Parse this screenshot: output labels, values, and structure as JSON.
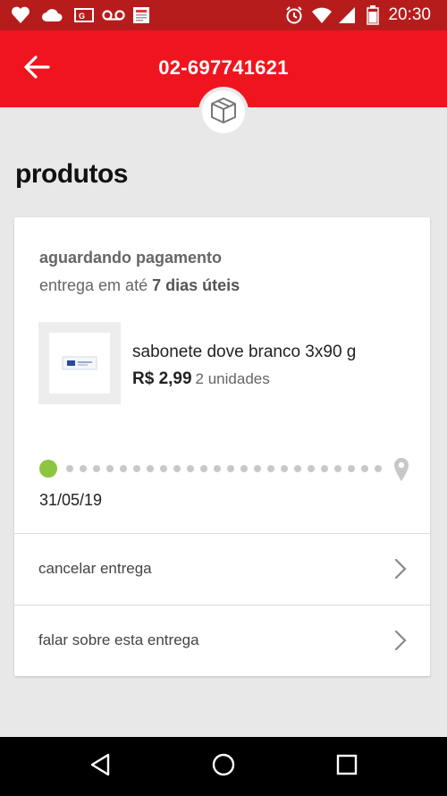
{
  "status_bar": {
    "time": "20:30",
    "icons": [
      "heart-icon",
      "cloud-icon",
      "card-icon",
      "voicemail-icon",
      "news-icon",
      "alarm-icon",
      "wifi-icon",
      "signal-icon",
      "battery-icon"
    ]
  },
  "app_bar": {
    "title": "02-697741621",
    "back_icon": "arrow-left-icon",
    "badge_icon": "box-icon"
  },
  "section": {
    "title": "produtos"
  },
  "card": {
    "status": "aguardando pagamento",
    "delivery_prefix": "entrega em até",
    "delivery_days": "7 dias úteis",
    "product": {
      "name": "sabonete dove branco 3x90 g",
      "price": "R$ 2,99",
      "units": "2 unidades"
    },
    "tracker": {
      "date": "31/05/19",
      "progress_colors": {
        "done": "#8cc63f",
        "pending": "#c8c8c8"
      }
    },
    "actions": [
      {
        "label": "cancelar entrega"
      },
      {
        "label": "falar sobre esta entrega"
      }
    ]
  },
  "colors": {
    "brand_red": "#f0141e",
    "status_bar": "#b71c1c",
    "background": "#e8e8e8"
  },
  "nav": {
    "icons": [
      "back-triangle-icon",
      "home-circle-icon",
      "recents-square-icon"
    ]
  }
}
